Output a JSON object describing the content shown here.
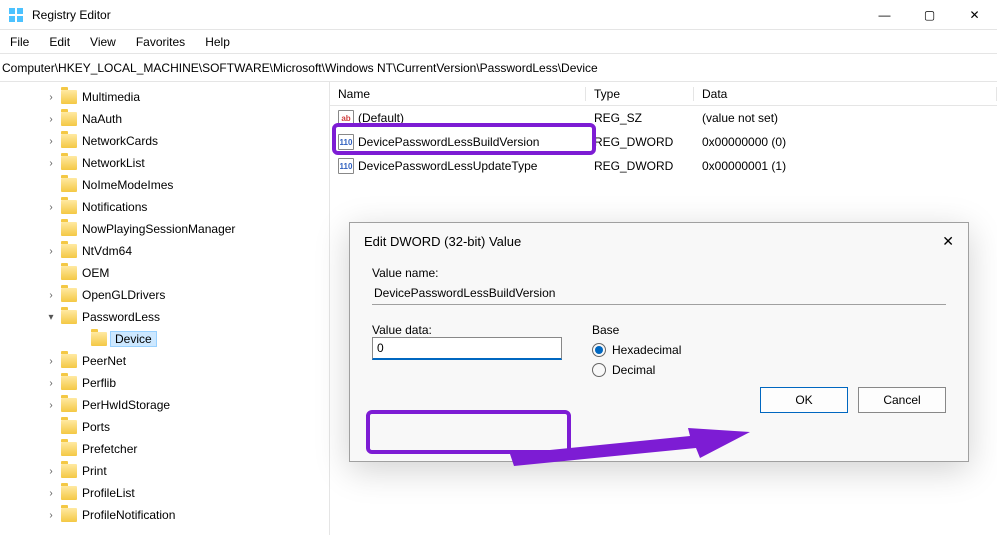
{
  "window": {
    "title": "Registry Editor",
    "min": "—",
    "max": "▢",
    "close": "✕"
  },
  "menu": [
    "File",
    "Edit",
    "View",
    "Favorites",
    "Help"
  ],
  "path": "Computer\\HKEY_LOCAL_MACHINE\\SOFTWARE\\Microsoft\\Windows NT\\CurrentVersion\\PasswordLess\\Device",
  "tree": [
    {
      "label": "Multimedia",
      "chev": ">"
    },
    {
      "label": "NaAuth",
      "chev": ">"
    },
    {
      "label": "NetworkCards",
      "chev": ">"
    },
    {
      "label": "NetworkList",
      "chev": ">"
    },
    {
      "label": "NoImeModeImes"
    },
    {
      "label": "Notifications",
      "chev": ">"
    },
    {
      "label": "NowPlayingSessionManager"
    },
    {
      "label": "NtVdm64",
      "chev": ">"
    },
    {
      "label": "OEM"
    },
    {
      "label": "OpenGLDrivers",
      "chev": ">"
    },
    {
      "label": "PasswordLess",
      "chev": "v",
      "expanded": true
    },
    {
      "label": "Device",
      "inner": true,
      "selected": true
    },
    {
      "label": "PeerNet",
      "chev": ">"
    },
    {
      "label": "Perflib",
      "chev": ">"
    },
    {
      "label": "PerHwIdStorage",
      "chev": ">"
    },
    {
      "label": "Ports"
    },
    {
      "label": "Prefetcher"
    },
    {
      "label": "Print",
      "chev": ">"
    },
    {
      "label": "ProfileList",
      "chev": ">"
    },
    {
      "label": "ProfileNotification",
      "chev": ">"
    }
  ],
  "list": {
    "headers": {
      "name": "Name",
      "type": "Type",
      "data": "Data"
    },
    "rows": [
      {
        "icon": "str",
        "name": "(Default)",
        "type": "REG_SZ",
        "data": "(value not set)"
      },
      {
        "icon": "bin",
        "name": "DevicePasswordLessBuildVersion",
        "type": "REG_DWORD",
        "data": "0x00000000 (0)",
        "highlighted": true
      },
      {
        "icon": "bin",
        "name": "DevicePasswordLessUpdateType",
        "type": "REG_DWORD",
        "data": "0x00000001 (1)"
      }
    ]
  },
  "dialog": {
    "title": "Edit DWORD (32-bit) Value",
    "close": "✕",
    "valname_label": "Value name:",
    "valname": "DevicePasswordLessBuildVersion",
    "valdata_label": "Value data:",
    "valdata": "0",
    "base_label": "Base",
    "hex": "Hexadecimal",
    "dec": "Decimal",
    "ok": "OK",
    "cancel": "Cancel"
  },
  "icon_text": {
    "str": "ab",
    "bin": "110"
  }
}
